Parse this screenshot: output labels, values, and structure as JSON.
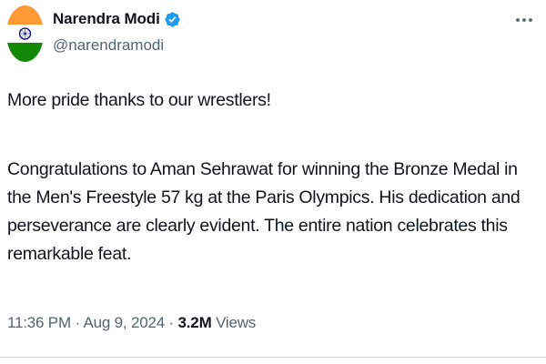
{
  "author": {
    "display_name": "Narendra Modi",
    "handle": "@narendramodi",
    "verified": true,
    "avatar_icon": "india-flag-avatar"
  },
  "post": {
    "line1": "More pride thanks to our wrestlers!",
    "line2": "Congratulations to Aman Sehrawat for winning the Bronze Medal in the Men's Freestyle 57 kg at the Paris Olympics. His dedication and perseverance are clearly evident. The entire nation celebrates this remarkable feat."
  },
  "meta": {
    "time": "11:36 PM",
    "separator": "·",
    "date": "Aug 9, 2024",
    "views_count": "3.2M",
    "views_label": "Views"
  },
  "colors": {
    "text": "#0f1419",
    "secondary": "#536471",
    "verified_blue": "#1d9bf0",
    "saffron": "#ff9933",
    "green": "#138808",
    "chakra": "#000080"
  },
  "icons": {
    "verified": "verified-badge-icon",
    "more": "more-options-icon"
  }
}
